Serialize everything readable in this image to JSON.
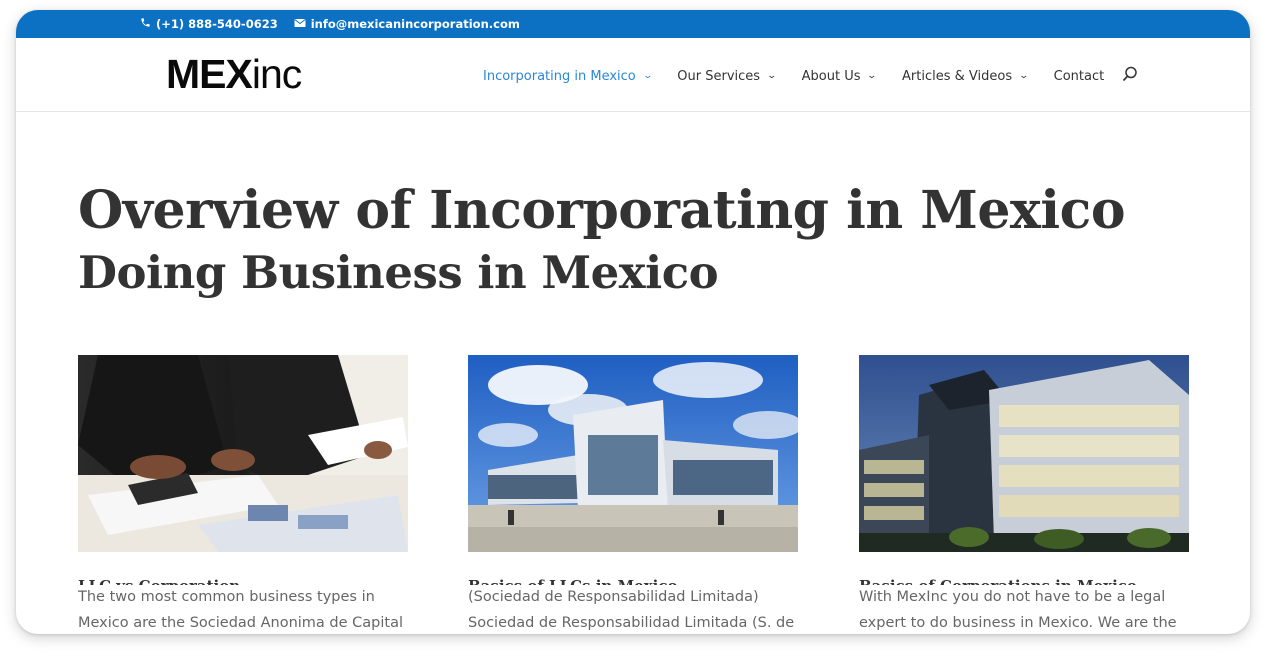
{
  "topbar": {
    "phone": "(+1) 888-540-0623",
    "email": "info@mexicanincorporation.com",
    "phone_icon": "phone-icon",
    "email_icon": "envelope-icon",
    "bg_color": "#0c71c3"
  },
  "header": {
    "logo_bold": "MEX",
    "logo_light": "inc",
    "nav": [
      {
        "label": "Incorporating in Mexico",
        "active": true,
        "dropdown": true
      },
      {
        "label": "Our Services",
        "active": false,
        "dropdown": true
      },
      {
        "label": "About Us",
        "active": false,
        "dropdown": true
      },
      {
        "label": "Articles & Videos",
        "active": false,
        "dropdown": true
      },
      {
        "label": "Contact",
        "active": false,
        "dropdown": false
      }
    ],
    "active_color": "#2b87da",
    "search_icon": "search-icon"
  },
  "main": {
    "title": "Overview of Incorporating in Mexico",
    "subtitle": "Doing Business in Mexico",
    "cards": [
      {
        "image": "business-documents-photo",
        "title": "LLC vs Corporation",
        "text": "The two most common business types in Mexico are the Sociedad Anonima de Capital"
      },
      {
        "image": "modern-glass-building-photo",
        "title": "Basics of LLCs in Mexico",
        "text": "(Sociedad de Responsabilidad Limitada) Sociedad de Responsabilidad Limitada (S. de"
      },
      {
        "image": "office-building-night-photo",
        "title": "Basics of Corporations in Mexico",
        "text": "With MexInc you do not have to be a legal expert to do business in Mexico. We are the"
      }
    ]
  }
}
